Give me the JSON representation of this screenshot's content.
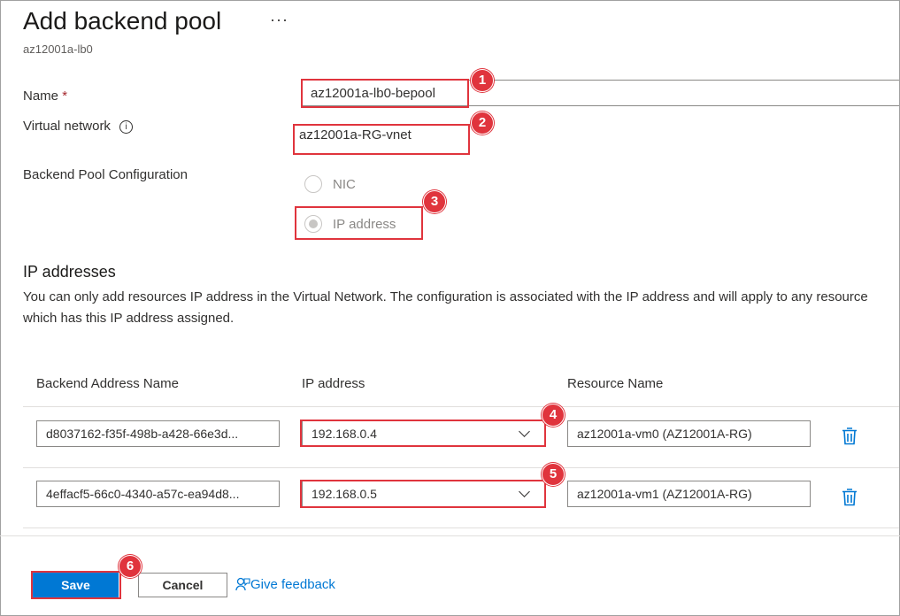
{
  "header": {
    "title": "Add backend pool",
    "more_label": "···",
    "subtitle": "az12001a-lb0"
  },
  "form": {
    "name_label": "Name",
    "required_marker": "*",
    "name_value": "az12001a-lb0-bepool",
    "vnet_label": "Virtual network",
    "info_glyph": "i",
    "vnet_value": "az12001a-RG-vnet",
    "config_label": "Backend Pool Configuration",
    "config_options": [
      {
        "label": "NIC",
        "selected": false
      },
      {
        "label": "IP address",
        "selected": true
      }
    ]
  },
  "ip_section": {
    "title": "IP addresses",
    "description": "You can only add resources IP address in the Virtual Network. The configuration is associated with the IP address and will apply to any resource which has this IP address assigned.",
    "columns": [
      "Backend Address Name",
      "IP address",
      "Resource Name"
    ],
    "rows": [
      {
        "backend_name": "d8037162-f35f-498b-a428-66e3d...",
        "ip": "192.168.0.4",
        "resource": "az12001a-vm0 (AZ12001A-RG)"
      },
      {
        "backend_name": "4effacf5-66c0-4340-a57c-ea94d8...",
        "ip": "192.168.0.5",
        "resource": "az12001a-vm1 (AZ12001A-RG)"
      }
    ]
  },
  "footer": {
    "save_label": "Save",
    "cancel_label": "Cancel",
    "feedback_label": "Give feedback"
  },
  "callouts": [
    "1",
    "2",
    "3",
    "4",
    "5",
    "6"
  ],
  "colors": {
    "accent": "#0078d4",
    "callout": "#e0343d"
  },
  "icons": {
    "more": "more-icon",
    "info": "info-icon",
    "chevron": "chevron-down-icon",
    "delete": "trash-icon",
    "feedback": "feedback-person-icon"
  }
}
